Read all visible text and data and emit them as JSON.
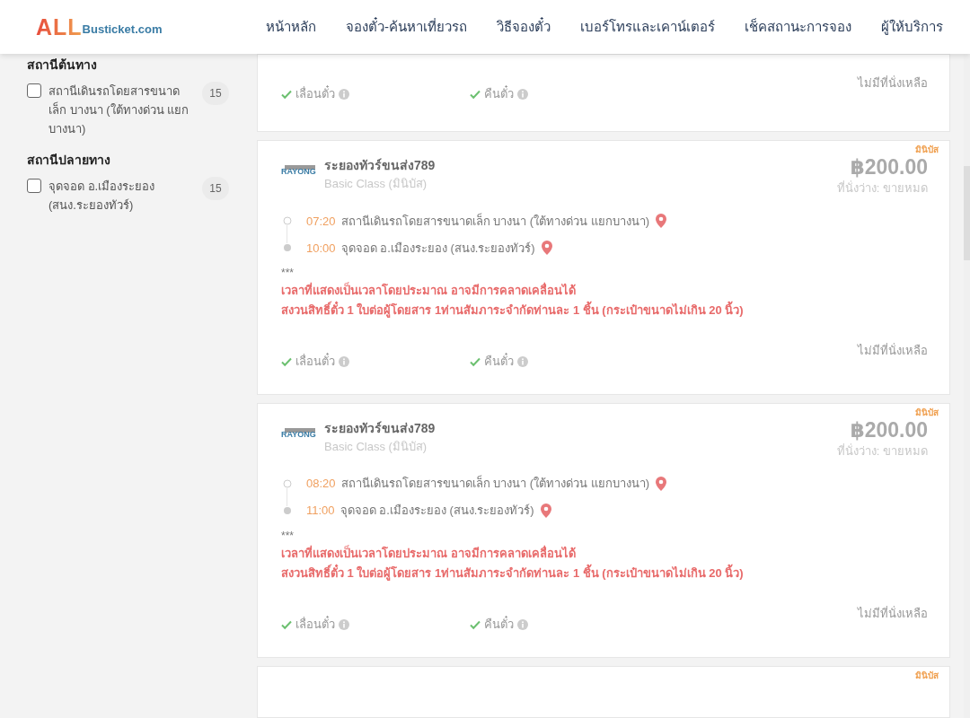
{
  "brand": {
    "main": "ALL",
    "rest": "Busticket.com"
  },
  "nav": [
    {
      "label": "หน้าหลัก"
    },
    {
      "label": "จองตั๋ว-ค้นหาเที่ยวรถ"
    },
    {
      "label": "วิธีจองตั๋ว"
    },
    {
      "label": "เบอร์โทรและเคาน์เตอร์"
    },
    {
      "label": "เช็คสถานะการจอง"
    },
    {
      "label": "ผู้ให้บริการ"
    }
  ],
  "filters": [
    {
      "title": "สถานีต้นทาง",
      "options": [
        {
          "label": "สถานีเดินรถโดยสารขนาดเล็ก บางนา (ใต้ทางด่วน แยกบางนา)",
          "count": "15",
          "checked": false
        }
      ]
    },
    {
      "title": "สถานีปลายทาง",
      "options": [
        {
          "label": "จุดจอด อ.เมืองระยอง (สนง.ระยองทัวร์)",
          "count": "15",
          "checked": false
        }
      ]
    }
  ],
  "trips": [
    {
      "kind": "footer",
      "features": [
        {
          "label": "เลื่อนตั๋ว",
          "available": true
        },
        {
          "label": "คืนตั๋ว",
          "available": true
        }
      ],
      "availability": "ไม่มีที่นั่งเหลือ"
    },
    {
      "kind": "full",
      "badge": "มินิบัส",
      "logo_text": "RAYONG",
      "operator": "ระยองทัวร์ขนส่ง789",
      "bus_class": "Basic Class (มินิบัส)",
      "price": "฿200.00",
      "seats": "ที่นั่งว่าง: ขายหมด",
      "stops": [
        {
          "time": "07:20",
          "place": "สถานีเดินรถโดยสารขนาดเล็ก บางนา (ใต้ทางด่วน แยกบางนา)"
        },
        {
          "time": "10:00",
          "place": "จุดจอด อ.เมืองระยอง (สนง.ระยองทัวร์)"
        }
      ],
      "note_marker": "***",
      "notes": [
        "เวลาที่แสดงเป็นเวลาโดยประมาณ อาจมีการคลาดเคลื่อนได้",
        "สงวนสิทธิ์ตั๋ว 1 ใบต่อผู้โดยสาร 1ท่านสัมภาระจำกัดท่านละ 1 ชิ้น (กระเป๋าขนาดไม่เกิน 20 นิ้ว)"
      ],
      "features": [
        {
          "label": "เลื่อนตั๋ว",
          "available": true
        },
        {
          "label": "คืนตั๋ว",
          "available": true
        }
      ],
      "availability": "ไม่มีที่นั่งเหลือ"
    },
    {
      "kind": "full",
      "badge": "มินิบัส",
      "logo_text": "RAYONG",
      "operator": "ระยองทัวร์ขนส่ง789",
      "bus_class": "Basic Class (มินิบัส)",
      "price": "฿200.00",
      "seats": "ที่นั่งว่าง: ขายหมด",
      "stops": [
        {
          "time": "08:20",
          "place": "สถานีเดินรถโดยสารขนาดเล็ก บางนา (ใต้ทางด่วน แยกบางนา)"
        },
        {
          "time": "11:00",
          "place": "จุดจอด อ.เมืองระยอง (สนง.ระยองทัวร์)"
        }
      ],
      "note_marker": "***",
      "notes": [
        "เวลาที่แสดงเป็นเวลาโดยประมาณ อาจมีการคลาดเคลื่อนได้",
        "สงวนสิทธิ์ตั๋ว 1 ใบต่อผู้โดยสาร 1ท่านสัมภาระจำกัดท่านละ 1 ชิ้น (กระเป๋าขนาดไม่เกิน 20 นิ้ว)"
      ],
      "features": [
        {
          "label": "เลื่อนตั๋ว",
          "available": true
        },
        {
          "label": "คืนตั๋ว",
          "available": true
        }
      ],
      "availability": "ไม่มีที่นั่งเหลือ"
    },
    {
      "kind": "header",
      "badge": "มินิบัส"
    }
  ]
}
